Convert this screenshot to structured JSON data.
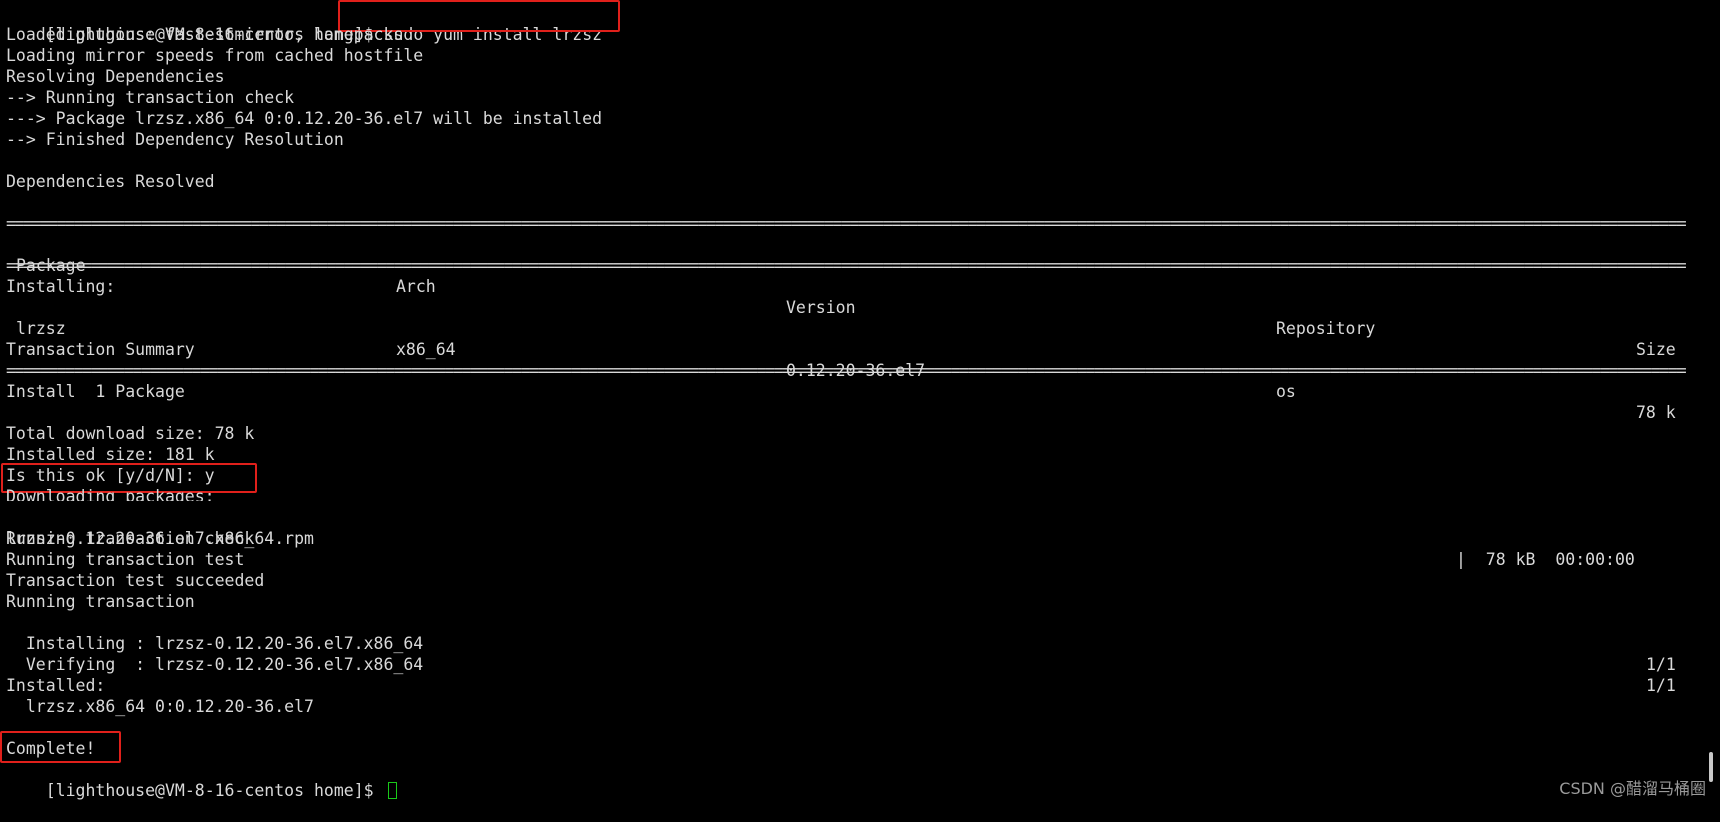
{
  "terminal": {
    "prompt": "[lighthouse@VM-8-16-centos home]$ ",
    "command": "sudo yum install lrzsz",
    "pre_lines": [
      "Loaded plugins: fastestmirror, langpacks",
      "Loading mirror speeds from cached hostfile",
      "Resolving Dependencies",
      "--> Running transaction check",
      "---> Package lrzsz.x86_64 0:0.12.20-36.el7 will be installed",
      "--> Finished Dependency Resolution",
      "",
      "Dependencies Resolved"
    ],
    "table": {
      "headers": {
        "package": "Package",
        "arch": "Arch",
        "version": "Version",
        "repository": "Repository",
        "size": "Size"
      },
      "section_label": "Installing:",
      "row": {
        "package": "lrzsz",
        "arch": "x86_64",
        "version": "0.12.20-36.el7",
        "repository": "os",
        "size": "78 k"
      }
    },
    "summary_label": "Transaction Summary",
    "install_count": "Install  1 Package",
    "total_download": "Total download size: 78 k",
    "installed_size": "Installed size: 181 k",
    "confirm_prompt": "Is this ok [y/d/N]: y",
    "downloading": "Downloading packages:",
    "rpm_file": "lrzsz-0.12.20-36.el7.x86_64.rpm",
    "rpm_progress": "|  78 kB  00:00:00",
    "post_lines": [
      "Running transaction check",
      "Running transaction test",
      "Transaction test succeeded",
      "Running transaction"
    ],
    "installing_line": "  Installing : lrzsz-0.12.20-36.el7.x86_64",
    "installing_count": "1/1",
    "verifying_line": "  Verifying  : lrzsz-0.12.20-36.el7.x86_64",
    "verifying_count": "1/1",
    "installed_label": "Installed:",
    "installed_pkg": "  lrzsz.x86_64 0:0.12.20-36.el7",
    "complete": "Complete!",
    "final_prompt": "[lighthouse@VM-8-16-centos home]$ "
  },
  "separator": "==================================================================================================================================================================================================================================",
  "watermark": "CSDN @醋溜马桶圈",
  "colors": {
    "background": "#000000",
    "text": "#d9d9d9",
    "highlight": "#e0201b",
    "cursor": "#19c919"
  }
}
